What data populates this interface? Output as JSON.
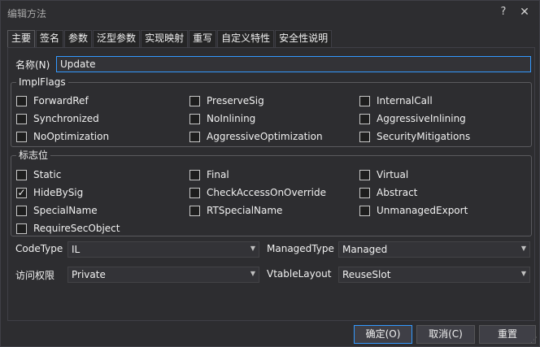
{
  "window": {
    "title": "编辑方法",
    "help_glyph": "?",
    "close_glyph": "✕"
  },
  "tabs": [
    {
      "label": "主要",
      "active": true
    },
    {
      "label": "签名",
      "active": false
    },
    {
      "label": "参数",
      "active": false
    },
    {
      "label": "泛型参数",
      "active": false
    },
    {
      "label": "实现映射",
      "active": false
    },
    {
      "label": "重写",
      "active": false
    },
    {
      "label": "自定义特性",
      "active": false
    },
    {
      "label": "安全性说明",
      "active": false
    }
  ],
  "name": {
    "label": "名称(N)",
    "value": "Update"
  },
  "impl_flags": {
    "legend": "ImplFlags",
    "items": [
      {
        "label": "ForwardRef",
        "checked": false
      },
      {
        "label": "PreserveSig",
        "checked": false
      },
      {
        "label": "InternalCall",
        "checked": false
      },
      {
        "label": "Synchronized",
        "checked": false
      },
      {
        "label": "NoInlining",
        "checked": false
      },
      {
        "label": "AggressiveInlining",
        "checked": false
      },
      {
        "label": "NoOptimization",
        "checked": false
      },
      {
        "label": "AggressiveOptimization",
        "checked": false
      },
      {
        "label": "SecurityMitigations",
        "checked": false
      }
    ]
  },
  "flags": {
    "legend": "标志位",
    "items": [
      {
        "label": "Static",
        "checked": false
      },
      {
        "label": "Final",
        "checked": false
      },
      {
        "label": "Virtual",
        "checked": false
      },
      {
        "label": "HideBySig",
        "checked": true
      },
      {
        "label": "CheckAccessOnOverride",
        "checked": false
      },
      {
        "label": "Abstract",
        "checked": false
      },
      {
        "label": "SpecialName",
        "checked": false
      },
      {
        "label": "RTSpecialName",
        "checked": false
      },
      {
        "label": "UnmanagedExport",
        "checked": false
      },
      {
        "label": "RequireSecObject",
        "checked": false
      }
    ]
  },
  "fields": {
    "code_type": {
      "label": "CodeType",
      "value": "IL"
    },
    "managed_type": {
      "label": "ManagedType",
      "value": "Managed"
    },
    "access": {
      "label": "访问权限",
      "value": "Private"
    },
    "vtable_layout": {
      "label": "VtableLayout",
      "value": "ReuseSlot"
    }
  },
  "buttons": {
    "ok": "确定(O)",
    "cancel": "取消(C)",
    "reset": "重置"
  },
  "check_glyph": "✓",
  "dropdown_glyph": "▼",
  "colors": {
    "accent": "#3399ff",
    "background": "#2d2d30"
  }
}
